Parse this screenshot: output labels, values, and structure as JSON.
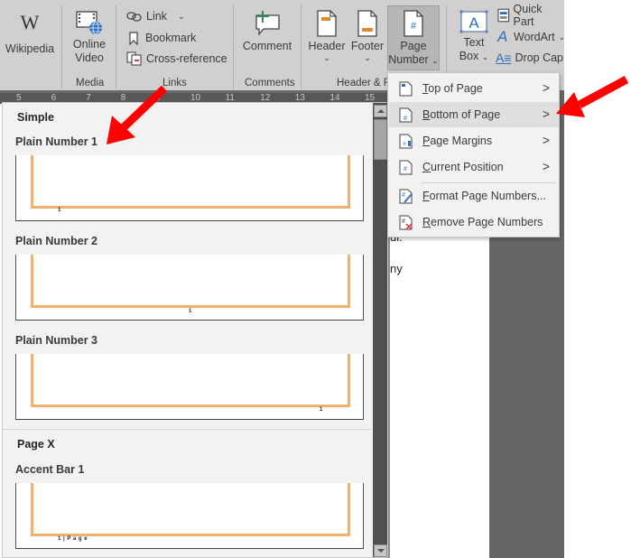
{
  "ribbon": {
    "wikipedia": {
      "label": "Wikipedia",
      "glyph": "W"
    },
    "online_video": {
      "label_line1": "Online",
      "label_line2": "Video"
    },
    "media_group": "Media",
    "links": {
      "link": "Link",
      "bookmark": "Bookmark",
      "cross_reference": "Cross-reference"
    },
    "links_group": "Links",
    "comment": {
      "label": "Comment"
    },
    "comments_group": "Comments",
    "header": {
      "label": "Header"
    },
    "footer": {
      "label": "Footer"
    },
    "page_number": {
      "label_line1": "Page",
      "label_line2": "Number"
    },
    "header_footer_group": "Header & F",
    "text_box": {
      "label_line1": "Text",
      "label_line2": "Box",
      "glyph": "A"
    },
    "quick_parts": "Quick Part",
    "wordart": "WordArt",
    "drop_cap": "Drop Cap"
  },
  "ruler": {
    "ticks": [
      "5",
      "6",
      "7",
      "8",
      "9",
      "10",
      "11",
      "12",
      "13",
      "14",
      "15"
    ]
  },
  "gallery": {
    "categories": [
      {
        "title": "Simple",
        "items": [
          {
            "label": "Plain Number 1",
            "preview_text": "1",
            "align": "left"
          },
          {
            "label": "Plain Number 2",
            "preview_text": "1",
            "align": "center"
          },
          {
            "label": "Plain Number 3",
            "preview_text": "1",
            "align": "right"
          }
        ]
      },
      {
        "title": "Page X",
        "items": [
          {
            "label": "Accent Bar 1",
            "preview_text": "1 | P a g e",
            "align": "left"
          }
        ]
      }
    ]
  },
  "document": {
    "lines": [
      "ul.",
      "ny"
    ]
  },
  "menu": {
    "items": [
      {
        "accel": "T",
        "rest": "op of Page",
        "has_submenu": true,
        "chevron": ">",
        "icon": "top-of-page-icon"
      },
      {
        "accel": "B",
        "rest": "ottom of Page",
        "has_submenu": true,
        "chevron": ">",
        "icon": "bottom-of-page-icon",
        "highlighted": true
      },
      {
        "accel": "P",
        "rest": "age Margins",
        "has_submenu": true,
        "chevron": ">",
        "icon": "page-margins-icon"
      },
      {
        "accel": "C",
        "rest": "urrent Position",
        "has_submenu": true,
        "chevron": ">",
        "icon": "current-position-icon"
      },
      {
        "accel": "F",
        "rest": "ormat Page Numbers...",
        "has_submenu": false,
        "icon": "format-page-numbers-icon"
      },
      {
        "accel": "R",
        "rest": "emove Page Numbers",
        "has_submenu": false,
        "icon": "remove-page-numbers-icon"
      }
    ]
  },
  "colors": {
    "ribbon_bg": "#d2d0ce",
    "menu_bg": "#f3f2f1",
    "menu_hover": "#e1dfdd",
    "accent_orange": "#f0b070",
    "annotation_red": "#ff0000",
    "doc_bg": "#666666"
  }
}
